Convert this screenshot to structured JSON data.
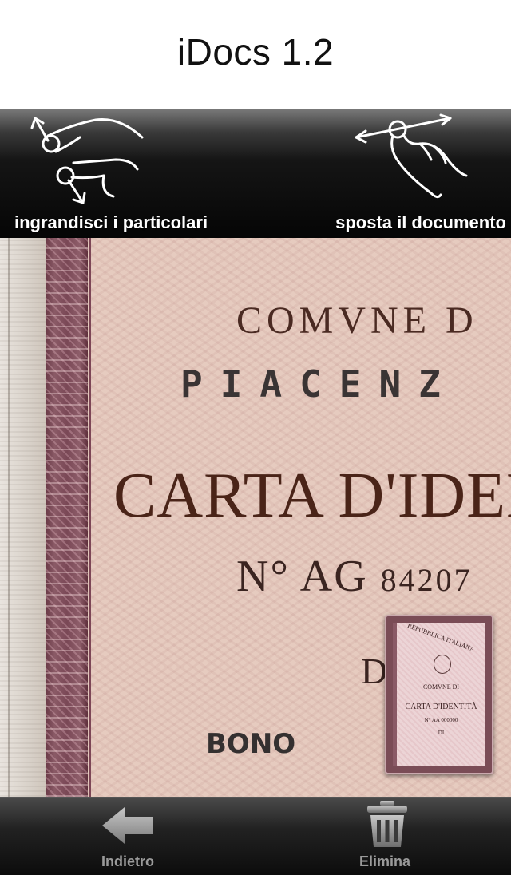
{
  "header": {
    "title": "iDocs 1.2"
  },
  "hints": {
    "left": {
      "label": "ingrandisci i particolari",
      "icon": "pinch-zoom-hand-icon"
    },
    "right": {
      "label": "sposta il documento",
      "icon": "pan-hand-icon"
    }
  },
  "document": {
    "line1": "COMVNE D",
    "line2": "PIACENZ",
    "line3": "CARTA D'IDEN",
    "number_prefix": "N°",
    "number": "AG",
    "number_digits": "84207",
    "line5": "D",
    "line6": "BONO"
  },
  "thumbnail": {
    "republic": "REPUBBLICA ITALIANA",
    "comune": "COMVNE DI",
    "title": "CARTA D'IDENTITÀ",
    "number": "N° AA 000000",
    "di": "DI"
  },
  "toolbar": {
    "back_label": "Indietro",
    "back_icon": "back-arrow-icon",
    "delete_label": "Elimina",
    "delete_icon": "trash-icon"
  }
}
